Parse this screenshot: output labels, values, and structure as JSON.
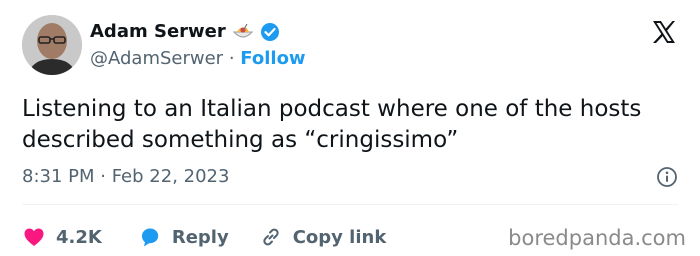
{
  "author": {
    "name": "Adam Serwer",
    "handle": "@AdamSerwer",
    "separator": "·",
    "follow_label": "Follow"
  },
  "tweet": {
    "text": "Listening to an Italian podcast where one of the hosts described something as “cringissimo”",
    "timestamp": "8:31 PM · Feb 22, 2023"
  },
  "actions": {
    "likes": "4.2K",
    "reply_label": "Reply",
    "copy_link_label": "Copy link"
  },
  "watermark": "boredpanda.com",
  "icons": {
    "name_emoji": "spaghetti-emoji-icon",
    "verified": "verified-badge-icon",
    "logo": "x-logo-icon",
    "info": "info-icon",
    "like": "heart-icon",
    "reply": "reply-bubble-icon",
    "copy_link": "link-icon"
  },
  "colors": {
    "accent": "#1d9bf0",
    "like": "#f91880",
    "text": "#0f1419",
    "muted": "#536471"
  }
}
